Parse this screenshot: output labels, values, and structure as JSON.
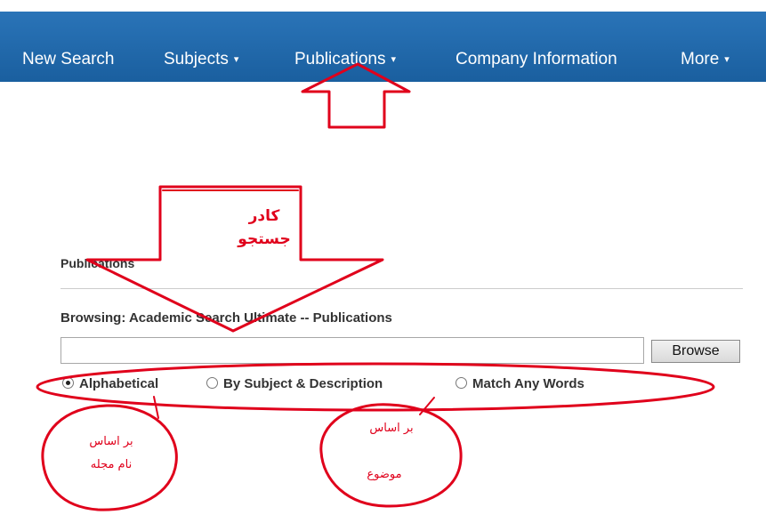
{
  "nav": {
    "items": [
      {
        "label": "New Search",
        "caret": ""
      },
      {
        "label": "Subjects",
        "caret": "▾"
      },
      {
        "label": "Publications",
        "caret": "▾"
      },
      {
        "label": "Company Information",
        "caret": ""
      },
      {
        "label": "More",
        "caret": "▾"
      }
    ]
  },
  "section": {
    "title": "Publications"
  },
  "browsing": {
    "label": "Browsing:  Academic Search Ultimate -- Publications"
  },
  "search": {
    "value": "",
    "placeholder": ""
  },
  "browse_button": {
    "label": "Browse"
  },
  "radios": [
    {
      "label": "Alphabetical",
      "checked": true
    },
    {
      "label": "By Subject & Description",
      "checked": false
    },
    {
      "label": "Match Any Words",
      "checked": false
    }
  ],
  "annotations": {
    "search_frame": {
      "line1": "کادر",
      "line2": "جستجو"
    },
    "by_journal": {
      "line1": "بر اساس",
      "line2": "نام مجله"
    },
    "by_subject": {
      "line1": "بر اساس",
      "line2": "موضوع"
    }
  },
  "colors": {
    "nav_bg": "#1e66aa",
    "annotation_red": "#e0001b"
  }
}
